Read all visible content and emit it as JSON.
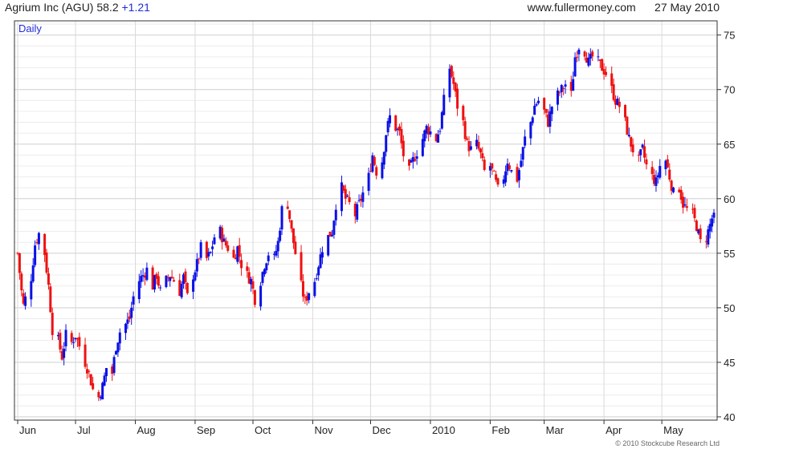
{
  "header": {
    "company": "Agrium Inc (AGU)",
    "price": "58.2",
    "change": "+1.21",
    "site": "www.fullermoney.com",
    "date": "27 May 2010"
  },
  "footer": {
    "copyright": "© 2010 Stockcube Research Ltd"
  },
  "colors": {
    "up": "#0a10e6",
    "down": "#ee1111",
    "grid": "#d6d6d6",
    "axis": "#333333",
    "bg": "#ffffff",
    "label": "#1e2bd6"
  },
  "chart_data": {
    "type": "candlestick",
    "title": "Agrium Inc (AGU)",
    "period_label": "Daily",
    "ylim": [
      39.7,
      76.3
    ],
    "y_ticks": [
      40,
      45,
      50,
      55,
      60,
      65,
      70,
      75
    ],
    "x_ticks": [
      "Jun",
      "Jul",
      "Aug",
      "Sep",
      "Oct",
      "Nov",
      "Dec",
      "2010",
      "Feb",
      "Mar",
      "Apr",
      "May"
    ],
    "grid": true,
    "y_axis_side": "right",
    "series_close_path": [
      [
        "2009-06-01",
        55.0
      ],
      [
        "2009-06-03",
        51.5
      ],
      [
        "2009-06-04",
        50.2
      ],
      [
        "2009-06-08",
        52.8
      ],
      [
        "2009-06-10",
        55.8
      ],
      [
        "2009-06-12",
        56.8
      ],
      [
        "2009-06-15",
        55.0
      ],
      [
        "2009-06-17",
        52.0
      ],
      [
        "2009-06-19",
        48.0
      ],
      [
        "2009-06-22",
        47.0
      ],
      [
        "2009-06-24",
        45.5
      ],
      [
        "2009-06-26",
        47.5
      ],
      [
        "2009-06-29",
        46.8
      ],
      [
        "2009-07-01",
        47.5
      ],
      [
        "2009-07-03",
        46.5
      ],
      [
        "2009-07-06",
        45.0
      ],
      [
        "2009-07-08",
        44.0
      ],
      [
        "2009-07-10",
        42.5
      ],
      [
        "2009-07-13",
        41.8
      ],
      [
        "2009-07-15",
        42.8
      ],
      [
        "2009-07-17",
        44.5
      ],
      [
        "2009-07-20",
        44.0
      ],
      [
        "2009-07-22",
        46.5
      ],
      [
        "2009-07-24",
        47.8
      ],
      [
        "2009-07-27",
        48.5
      ],
      [
        "2009-07-29",
        49.0
      ],
      [
        "2009-07-31",
        51.0
      ],
      [
        "2009-08-03",
        52.5
      ],
      [
        "2009-08-05",
        53.0
      ],
      [
        "2009-08-07",
        53.5
      ],
      [
        "2009-08-10",
        52.0
      ],
      [
        "2009-08-12",
        53.0
      ],
      [
        "2009-08-14",
        51.5
      ],
      [
        "2009-08-17",
        52.5
      ],
      [
        "2009-08-19",
        53.0
      ],
      [
        "2009-08-21",
        52.5
      ],
      [
        "2009-08-24",
        51.5
      ],
      [
        "2009-08-26",
        52.8
      ],
      [
        "2009-08-28",
        51.0
      ],
      [
        "2009-08-31",
        53.0
      ],
      [
        "2009-09-02",
        54.0
      ],
      [
        "2009-09-04",
        55.5
      ],
      [
        "2009-09-07",
        54.5
      ],
      [
        "2009-09-09",
        55.0
      ],
      [
        "2009-09-11",
        56.5
      ],
      [
        "2009-09-14",
        57.0
      ],
      [
        "2009-09-16",
        56.0
      ],
      [
        "2009-09-18",
        55.5
      ],
      [
        "2009-09-21",
        54.5
      ],
      [
        "2009-09-23",
        55.5
      ],
      [
        "2009-09-25",
        54.0
      ],
      [
        "2009-09-28",
        53.0
      ],
      [
        "2009-09-30",
        52.5
      ],
      [
        "2009-10-02",
        50.8
      ],
      [
        "2009-10-05",
        52.5
      ],
      [
        "2009-10-07",
        54.0
      ],
      [
        "2009-10-09",
        55.0
      ],
      [
        "2009-10-12",
        54.5
      ],
      [
        "2009-10-14",
        56.0
      ],
      [
        "2009-10-16",
        59.0
      ],
      [
        "2009-10-19",
        59.5
      ],
      [
        "2009-10-21",
        57.0
      ],
      [
        "2009-10-23",
        55.0
      ],
      [
        "2009-10-26",
        52.0
      ],
      [
        "2009-10-28",
        50.5
      ],
      [
        "2009-10-30",
        51.5
      ],
      [
        "2009-11-02",
        52.5
      ],
      [
        "2009-11-04",
        54.0
      ],
      [
        "2009-11-06",
        55.5
      ],
      [
        "2009-11-09",
        56.5
      ],
      [
        "2009-11-11",
        57.0
      ],
      [
        "2009-11-13",
        59.5
      ],
      [
        "2009-11-16",
        61.0
      ],
      [
        "2009-11-18",
        60.0
      ],
      [
        "2009-11-20",
        59.5
      ],
      [
        "2009-11-23",
        58.5
      ],
      [
        "2009-11-25",
        59.5
      ],
      [
        "2009-11-27",
        60.5
      ],
      [
        "2009-11-30",
        62.0
      ],
      [
        "2009-12-02",
        64.0
      ],
      [
        "2009-12-04",
        62.5
      ],
      [
        "2009-12-07",
        63.5
      ],
      [
        "2009-12-09",
        66.0
      ],
      [
        "2009-12-11",
        67.5
      ],
      [
        "2009-12-14",
        66.5
      ],
      [
        "2009-12-16",
        66.0
      ],
      [
        "2009-12-18",
        64.0
      ],
      [
        "2009-12-21",
        62.5
      ],
      [
        "2009-12-23",
        63.5
      ],
      [
        "2009-12-28",
        65.5
      ],
      [
        "2009-12-30",
        66.5
      ],
      [
        "2010-01-04",
        65.5
      ],
      [
        "2010-01-06",
        66.5
      ],
      [
        "2010-01-08",
        69.0
      ],
      [
        "2010-01-11",
        72.0
      ],
      [
        "2010-01-13",
        70.5
      ],
      [
        "2010-01-15",
        68.5
      ],
      [
        "2010-01-18",
        67.0
      ],
      [
        "2010-01-20",
        65.0
      ],
      [
        "2010-01-22",
        64.5
      ],
      [
        "2010-01-25",
        65.0
      ],
      [
        "2010-01-27",
        64.0
      ],
      [
        "2010-01-29",
        62.5
      ],
      [
        "2010-02-01",
        63.0
      ],
      [
        "2010-02-03",
        62.0
      ],
      [
        "2010-02-05",
        60.8
      ],
      [
        "2010-02-08",
        62.0
      ],
      [
        "2010-02-10",
        63.5
      ],
      [
        "2010-02-12",
        62.5
      ],
      [
        "2010-02-15",
        61.8
      ],
      [
        "2010-02-17",
        63.5
      ],
      [
        "2010-02-19",
        65.5
      ],
      [
        "2010-02-22",
        67.0
      ],
      [
        "2010-02-24",
        68.5
      ],
      [
        "2010-02-26",
        69.0
      ],
      [
        "2010-03-01",
        68.0
      ],
      [
        "2010-03-03",
        67.0
      ],
      [
        "2010-03-05",
        68.5
      ],
      [
        "2010-03-08",
        69.5
      ],
      [
        "2010-03-10",
        70.0
      ],
      [
        "2010-03-12",
        70.5
      ],
      [
        "2010-03-15",
        69.5
      ],
      [
        "2010-03-17",
        73.0
      ],
      [
        "2010-03-19",
        74.0
      ],
      [
        "2010-03-22",
        73.5
      ],
      [
        "2010-03-24",
        72.5
      ],
      [
        "2010-03-26",
        73.0
      ],
      [
        "2010-03-29",
        72.5
      ],
      [
        "2010-03-31",
        72.0
      ],
      [
        "2010-04-02",
        71.5
      ],
      [
        "2010-04-05",
        70.0
      ],
      [
        "2010-04-07",
        69.0
      ],
      [
        "2010-04-09",
        68.5
      ],
      [
        "2010-04-12",
        67.0
      ],
      [
        "2010-04-14",
        65.5
      ],
      [
        "2010-04-16",
        64.5
      ],
      [
        "2010-04-19",
        63.5
      ],
      [
        "2010-04-21",
        64.5
      ],
      [
        "2010-04-23",
        63.0
      ],
      [
        "2010-04-26",
        62.0
      ],
      [
        "2010-04-28",
        61.5
      ],
      [
        "2010-04-30",
        63.0
      ],
      [
        "2010-05-03",
        63.5
      ],
      [
        "2010-05-05",
        62.0
      ],
      [
        "2010-05-07",
        60.5
      ],
      [
        "2010-05-10",
        61.0
      ],
      [
        "2010-05-12",
        59.5
      ],
      [
        "2010-05-14",
        59.0
      ],
      [
        "2010-05-17",
        58.5
      ],
      [
        "2010-05-19",
        57.5
      ],
      [
        "2010-05-21",
        56.0
      ],
      [
        "2010-05-24",
        56.5
      ],
      [
        "2010-05-25",
        57.0
      ],
      [
        "2010-05-27",
        58.2
      ]
    ]
  }
}
